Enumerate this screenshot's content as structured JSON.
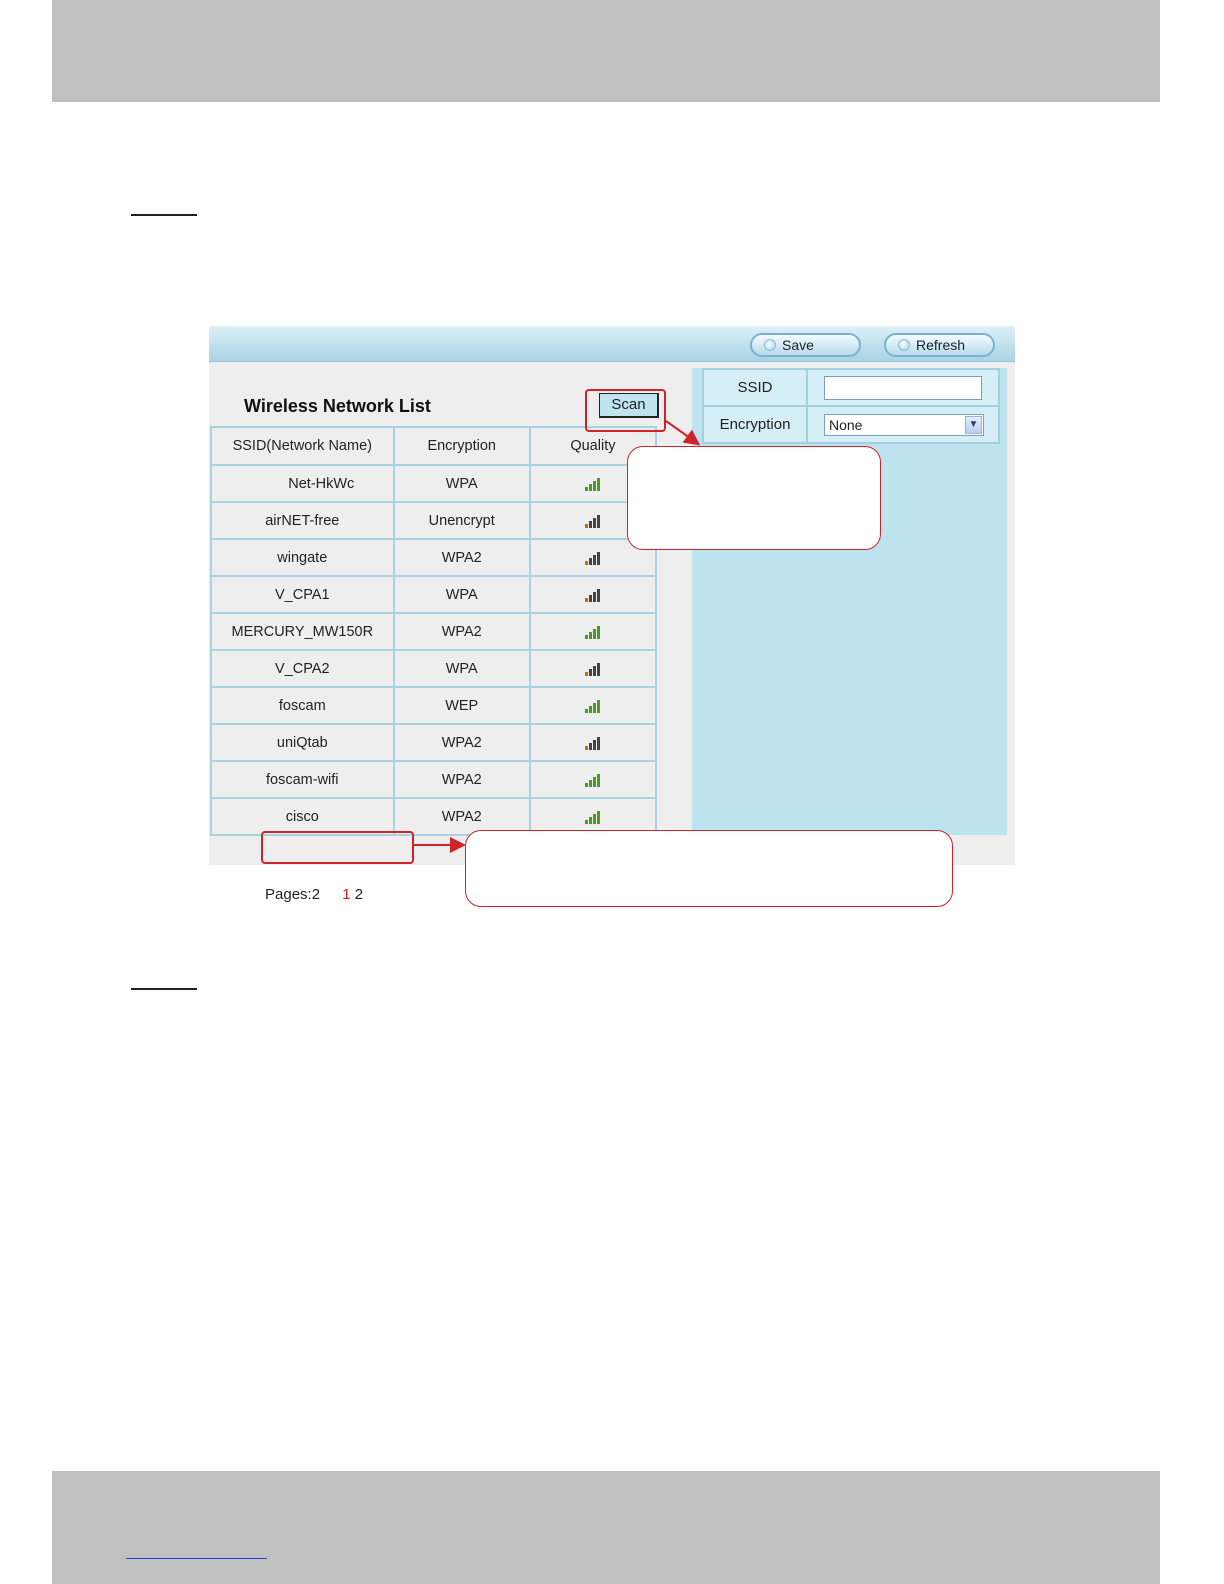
{
  "toolbar": {
    "save_label": "Save",
    "refresh_label": "Refresh"
  },
  "list": {
    "title": "Wireless Network List",
    "scan_label": "Scan",
    "columns": [
      "SSID(Network Name)",
      "Encryption",
      "Quality"
    ],
    "rows": [
      {
        "ssid": "Net-HkWc",
        "encryption": "WPA",
        "quality_icon": "signal-strong-icon"
      },
      {
        "ssid": "airNET-free",
        "encryption": "Unencrypt",
        "quality_icon": "signal-weak-icon"
      },
      {
        "ssid": "wingate",
        "encryption": "WPA2",
        "quality_icon": "signal-weak-icon"
      },
      {
        "ssid": "V_CPA1",
        "encryption": "WPA",
        "quality_icon": "signal-weak-icon"
      },
      {
        "ssid": "MERCURY_MW150R",
        "encryption": "WPA2",
        "quality_icon": "signal-strong-icon"
      },
      {
        "ssid": "V_CPA2",
        "encryption": "WPA",
        "quality_icon": "signal-weak-icon"
      },
      {
        "ssid": "foscam",
        "encryption": "WEP",
        "quality_icon": "signal-strong-icon"
      },
      {
        "ssid": "uniQtab",
        "encryption": "WPA2",
        "quality_icon": "signal-weak-icon"
      },
      {
        "ssid": "foscam-wifi",
        "encryption": "WPA2",
        "quality_icon": "signal-strong-icon"
      },
      {
        "ssid": "cisco",
        "encryption": "WPA2",
        "quality_icon": "signal-strong-icon"
      }
    ],
    "pages_label": "Pages:2",
    "page_current": "1",
    "page_next": "2"
  },
  "form": {
    "ssid_label": "SSID",
    "ssid_value": "",
    "encryption_label": "Encryption",
    "encryption_value": "None"
  },
  "colors": {
    "annotation": "#d0232a",
    "panel_blue": "#bde3ef",
    "signal_strong": "#4a9a26"
  }
}
